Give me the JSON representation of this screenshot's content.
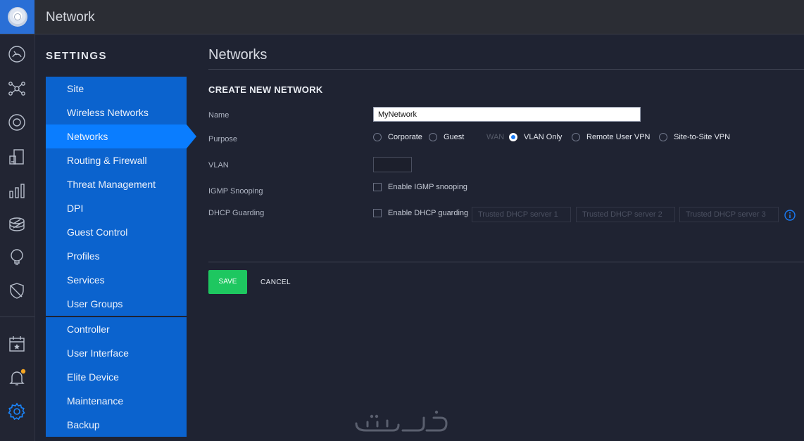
{
  "app": {
    "title": "Network"
  },
  "rail": {
    "icons": [
      "dashboard-icon",
      "topology-icon",
      "devices-icon",
      "clients-icon",
      "statistics-icon",
      "insights-icon",
      "alerts-icon",
      "security-icon",
      "events-icon",
      "notifications-icon",
      "settings-icon"
    ]
  },
  "sidebar": {
    "heading": "SETTINGS",
    "groups": [
      {
        "items": [
          {
            "label": "Site"
          },
          {
            "label": "Wireless Networks"
          },
          {
            "label": "Networks",
            "active": true
          },
          {
            "label": "Routing & Firewall"
          },
          {
            "label": "Threat Management"
          },
          {
            "label": "DPI"
          },
          {
            "label": "Guest Control"
          },
          {
            "label": "Profiles"
          },
          {
            "label": "Services"
          },
          {
            "label": "User Groups"
          }
        ]
      },
      {
        "items": [
          {
            "label": "Controller"
          },
          {
            "label": "User Interface"
          },
          {
            "label": "Elite Device"
          },
          {
            "label": "Maintenance"
          },
          {
            "label": "Backup"
          }
        ]
      }
    ]
  },
  "main": {
    "page_title": "Networks",
    "section_title": "CREATE NEW NETWORK",
    "fields": {
      "name_label": "Name",
      "name_value": "MyNetwork",
      "purpose_label": "Purpose",
      "purpose_options": [
        {
          "label": "Corporate",
          "state": "unchecked"
        },
        {
          "label": "Guest",
          "state": "unchecked"
        },
        {
          "label": "WAN",
          "state": "disabled"
        },
        {
          "label": "VLAN Only",
          "state": "checked"
        },
        {
          "label": "Remote User VPN",
          "state": "unchecked"
        },
        {
          "label": "Site-to-Site VPN",
          "state": "unchecked"
        }
      ],
      "vlan_label": "VLAN",
      "vlan_value": "",
      "igmp_label": "IGMP Snooping",
      "igmp_checkbox_label": "Enable IGMP snooping",
      "igmp_checked": false,
      "dhcp_label": "DHCP Guarding",
      "dhcp_checkbox_label": "Enable DHCP guarding",
      "dhcp_checked": false,
      "dhcp_servers_placeholders": [
        "Trusted DHCP server 1",
        "Trusted DHCP server 2",
        "Trusted DHCP server 3"
      ]
    },
    "actions": {
      "save": "SAVE",
      "cancel": "CANCEL"
    }
  },
  "colors": {
    "accent": "#0a7dff",
    "menu": "#0b63ce",
    "save": "#1ec760",
    "notification_dot": "#f5a623"
  }
}
